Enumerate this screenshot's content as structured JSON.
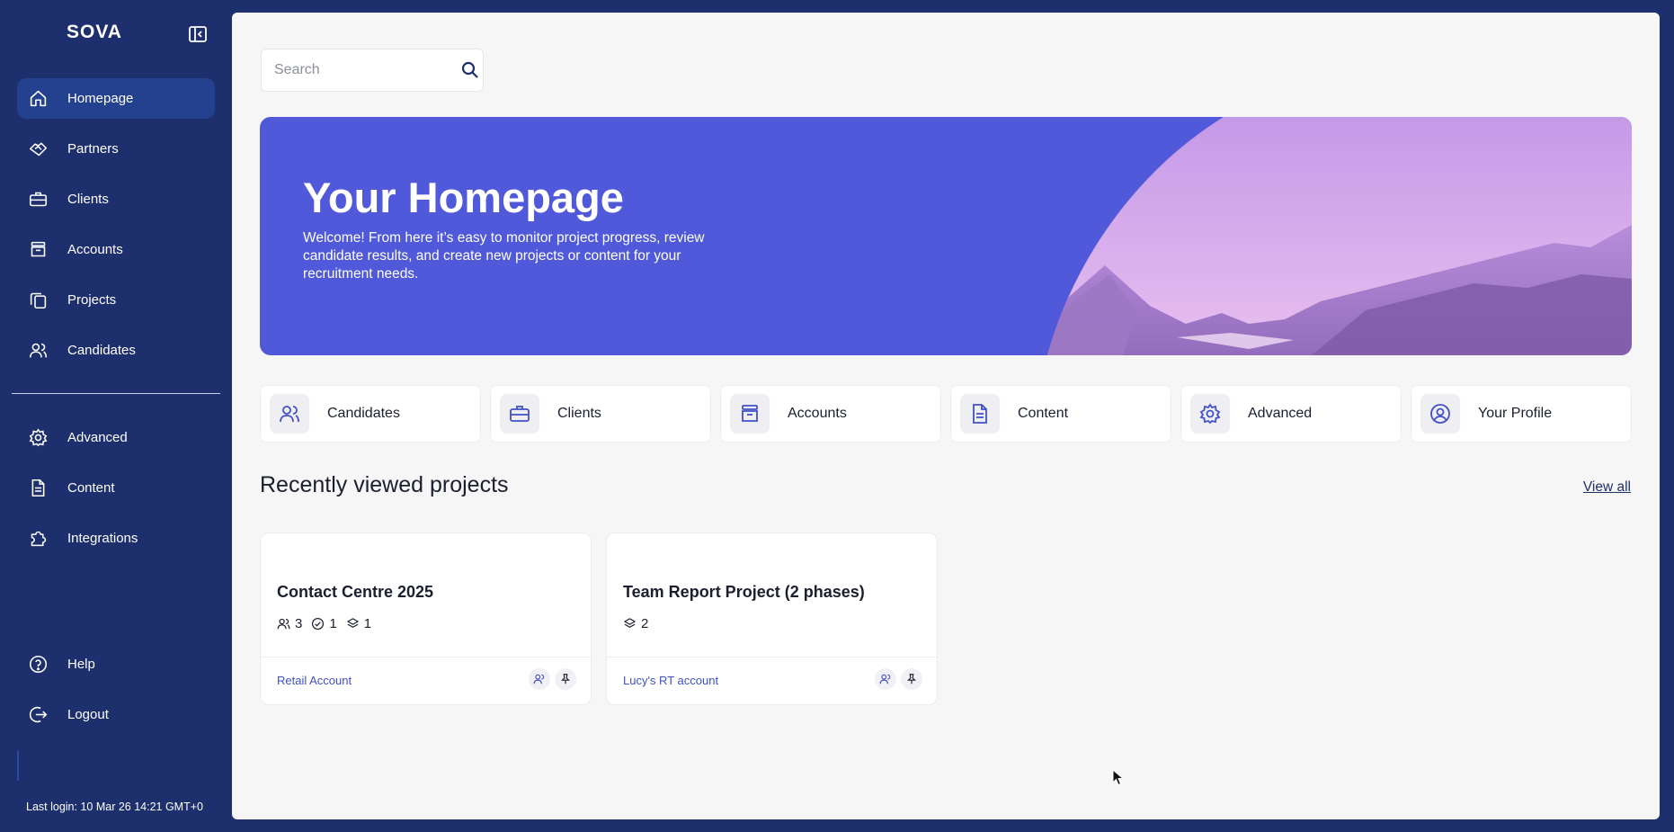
{
  "app": {
    "logo": "SOVA"
  },
  "sidebar": {
    "collapse_icon": "sidebar-collapse-icon",
    "items": [
      {
        "label": "Homepage",
        "icon": "home-icon",
        "active": true
      },
      {
        "label": "Partners",
        "icon": "handshake-icon"
      },
      {
        "label": "Clients",
        "icon": "briefcase-icon"
      },
      {
        "label": "Accounts",
        "icon": "archive-icon"
      },
      {
        "label": "Projects",
        "icon": "copy-icon"
      },
      {
        "label": "Candidates",
        "icon": "users-icon"
      },
      {
        "label": "Advanced",
        "icon": "gear-icon"
      },
      {
        "label": "Content",
        "icon": "document-icon"
      },
      {
        "label": "Integrations",
        "icon": "puzzle-icon"
      },
      {
        "label": "Help",
        "icon": "help-icon"
      },
      {
        "label": "Logout",
        "icon": "logout-icon"
      }
    ],
    "last_login": "Last login: 10 Mar 26 14:21 GMT+0"
  },
  "search": {
    "placeholder": "Search",
    "value": ""
  },
  "hero": {
    "title": "Your Homepage",
    "text": "Welcome! From here it’s easy to monitor project progress, review candidate results, and create new projects or content for your recruitment needs."
  },
  "quick_links": [
    {
      "label": "Candidates",
      "icon": "users-icon"
    },
    {
      "label": "Clients",
      "icon": "briefcase-icon"
    },
    {
      "label": "Accounts",
      "icon": "archive-icon"
    },
    {
      "label": "Content",
      "icon": "document-icon"
    },
    {
      "label": "Advanced",
      "icon": "gear-icon"
    },
    {
      "label": "Your Profile",
      "icon": "user-circle-icon"
    }
  ],
  "recent": {
    "title": "Recently viewed projects",
    "view_all": "View all",
    "projects": [
      {
        "name": "Contact Centre 2025",
        "candidates": "3",
        "completed": "1",
        "phases": "1",
        "account": "Retail Account"
      },
      {
        "name": "Team Report Project (2 phases)",
        "phases": "2",
        "account": "Lucy's RT account"
      }
    ]
  },
  "colors": {
    "sidebar": "#1e2f6e",
    "active": "#24418f",
    "hero": "#5059d9",
    "accent": "#4150c8"
  }
}
